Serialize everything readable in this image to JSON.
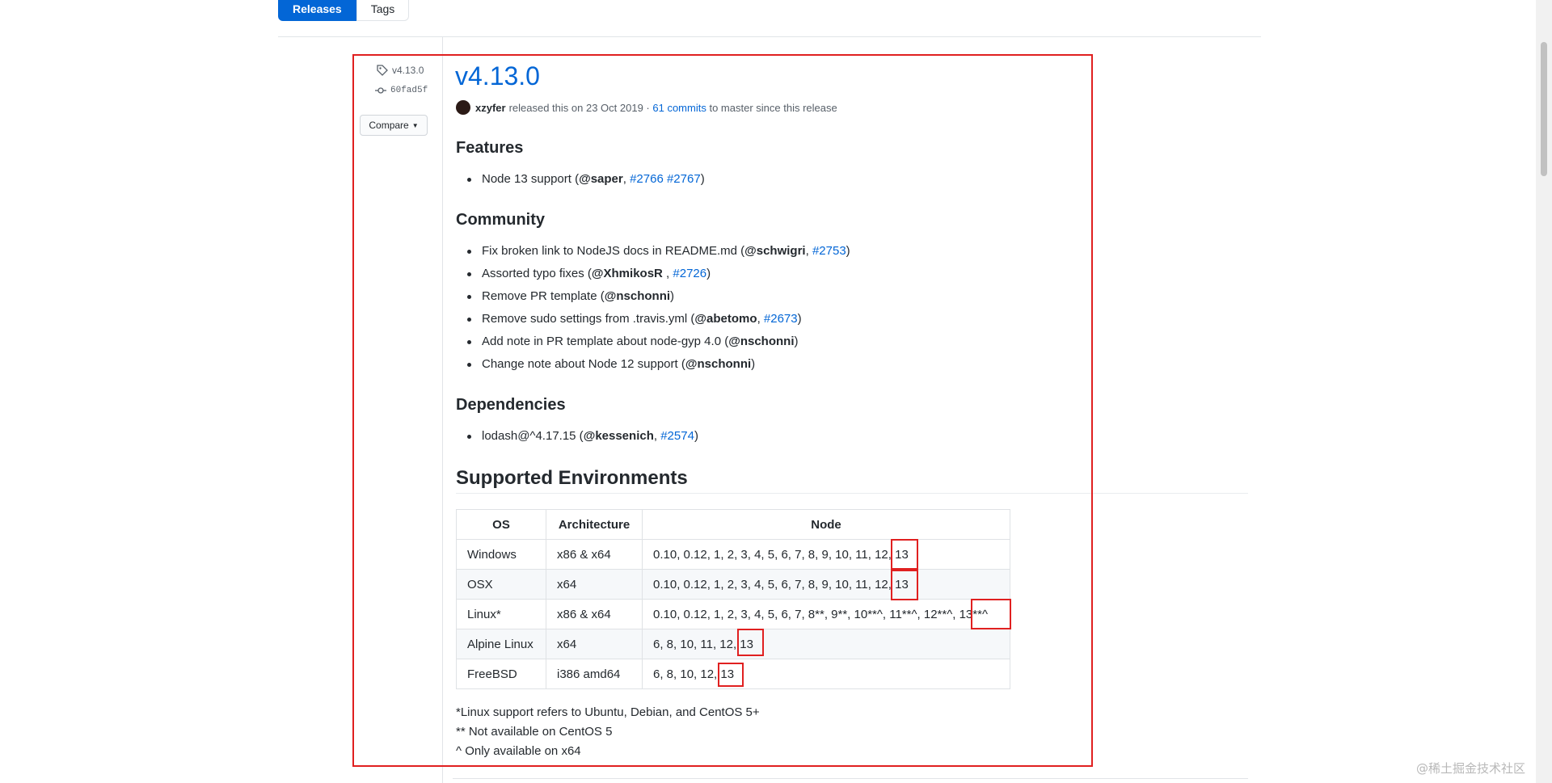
{
  "tabs": {
    "releases": "Releases",
    "tags": "Tags"
  },
  "sidebar": {
    "tag": "v4.13.0",
    "commit": "60fad5f",
    "compare": "Compare"
  },
  "release": {
    "version": "v4.13.0",
    "author": "xzyfer",
    "released_text": "released this on 23 Oct 2019 ·",
    "commits_link": "61 commits",
    "commits_suffix": "to master since this release"
  },
  "features": {
    "heading": "Features",
    "items": [
      {
        "pre": "Node 13 support (",
        "user": "@saper",
        "sep": ", ",
        "link1": "#2766",
        "link2": "#2767",
        "post": ")"
      }
    ]
  },
  "community": {
    "heading": "Community",
    "items": [
      {
        "pre": "Fix broken link to NodeJS docs in README.md (",
        "user": "@schwigri",
        "sep": ", ",
        "link": "#2753",
        "post": ")"
      },
      {
        "pre": "Assorted typo fixes (",
        "user": "@XhmikosR",
        "sep": " , ",
        "link": "#2726",
        "post": ")"
      },
      {
        "pre": "Remove PR template (",
        "user": "@nschonni",
        "post": ")"
      },
      {
        "pre": "Remove sudo settings from .travis.yml (",
        "user": "@abetomo",
        "sep": ", ",
        "link": "#2673",
        "post": ")"
      },
      {
        "pre": "Add note in PR template about node-gyp 4.0 (",
        "user": "@nschonni",
        "post": ")"
      },
      {
        "pre": "Change note about Node 12 support (",
        "user": "@nschonni",
        "post": ")"
      }
    ]
  },
  "dependencies": {
    "heading": "Dependencies",
    "items": [
      {
        "pre": "lodash@^4.17.15 (",
        "user": "@kessenich",
        "sep": ", ",
        "link": "#2574",
        "post": ")"
      }
    ]
  },
  "environments": {
    "heading": "Supported Environments",
    "headers": [
      "OS",
      "Architecture",
      "Node"
    ],
    "rows": [
      {
        "os": "Windows",
        "arch": "x86 & x64",
        "node": "0.10, 0.12, 1, 2, 3, 4, 5, 6, 7, 8, 9, 10, 11, 12, 13"
      },
      {
        "os": "OSX",
        "arch": "x64",
        "node": "0.10, 0.12, 1, 2, 3, 4, 5, 6, 7, 8, 9, 10, 11, 12, 13"
      },
      {
        "os": "Linux*",
        "arch": "x86 & x64",
        "node": "0.10, 0.12, 1, 2, 3, 4, 5, 6, 7, 8**, 9**, 10**^, 11**^, 12**^, 13**^"
      },
      {
        "os": "Alpine Linux",
        "arch": "x64",
        "node": "6, 8, 10, 11, 12, 13"
      },
      {
        "os": "FreeBSD",
        "arch": "i386 amd64",
        "node": "6, 8, 10, 12, 13"
      }
    ],
    "notes": [
      "*Linux support refers to Ubuntu, Debian, and CentOS 5+",
      "** Not available on CentOS 5",
      "^ Only available on x64"
    ]
  },
  "watermark": "@稀土掘金技术社区",
  "colors": {
    "link": "#0366d6",
    "accent": "#0366d6",
    "highlight_box": "#e02020"
  }
}
